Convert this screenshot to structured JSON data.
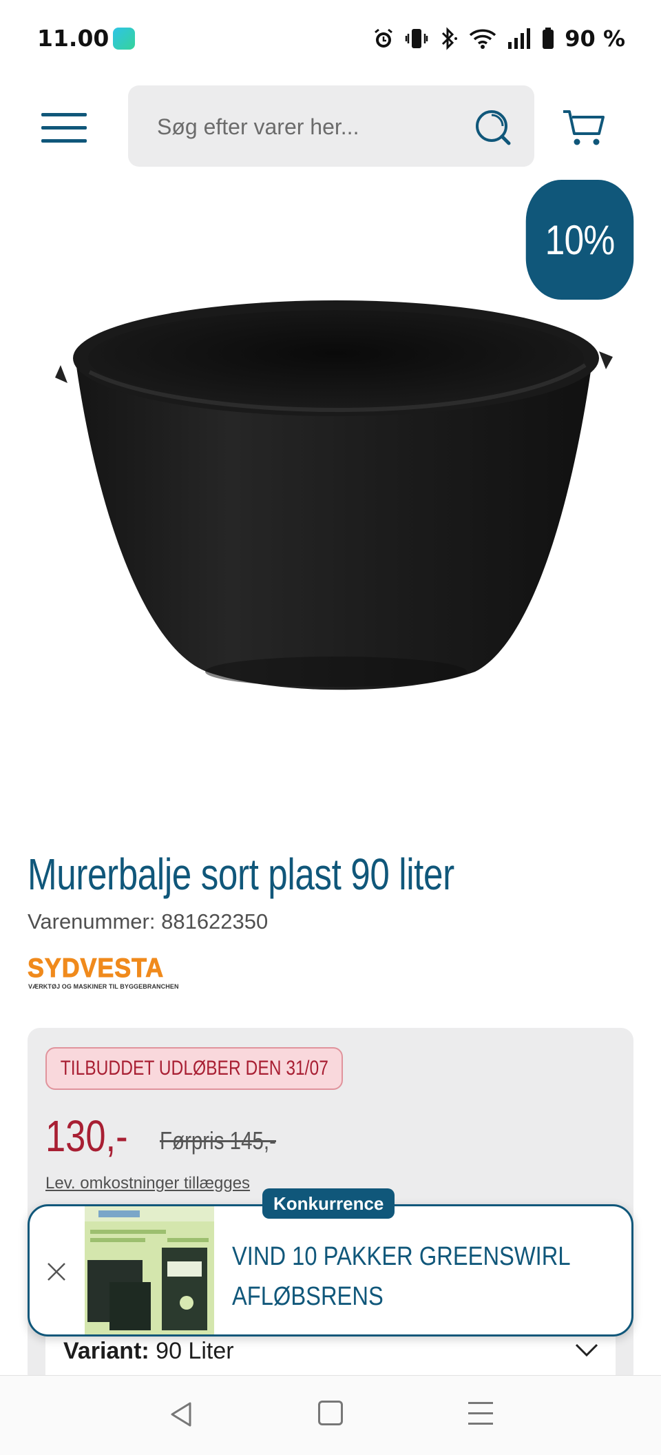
{
  "status_bar": {
    "time": "11.00",
    "battery": "90 %"
  },
  "header": {
    "search": {
      "placeholder": "Søg efter varer her..."
    }
  },
  "badge": {
    "discount": "10%"
  },
  "product": {
    "title": "Murerbalje sort plast 90 liter",
    "sku": "Varenummer: 881622350",
    "brand": {
      "name": "SYDVESTA",
      "tagline": "VÆRKTØJ OG MASKINER TIL BYGGEBRANCHEN"
    }
  },
  "pricing": {
    "offer_tag": "TILBUDDET UDLØBER DEN 31/07",
    "current_price": "130,-",
    "old_price": "Førpris 145,-",
    "shipping_note": "Lev. omkostninger tillægges",
    "variant_label": "Variant:",
    "variant_value": "90 Liter"
  },
  "promo": {
    "label": "Konkurrence",
    "headline_line1": "VIND 10 PAKKER GREENSWIRL",
    "headline_line2": "AFLØBSRENS"
  },
  "colors": {
    "brand_blue": "#10577a",
    "sale_red": "#a81f33",
    "brand_orange": "#f08a1c"
  },
  "icons": [
    "menu-icon",
    "search-icon",
    "cart-icon",
    "close-icon",
    "chevron-down-icon",
    "nav-back-icon",
    "nav-home-icon",
    "nav-recents-icon"
  ]
}
